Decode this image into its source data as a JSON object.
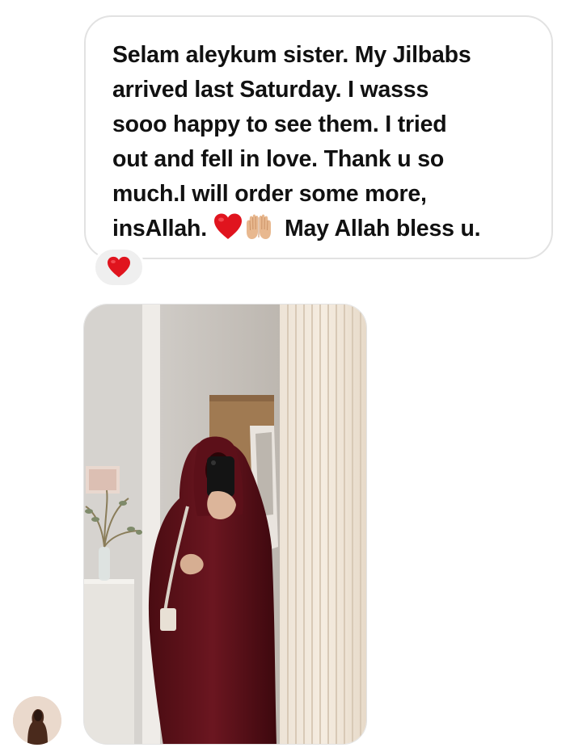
{
  "message": {
    "lines": [
      "Selam aleykum sister. My Jilbabs",
      "arrived last Saturday. I wasss",
      "sooo happy to see them. I tried",
      "out and fell in love. Thank u so",
      "much.I  will order some more,"
    ],
    "last_line_start": "insAllah.",
    "last_line_end": "May Allah bless u.",
    "inline_emojis": [
      "red-heart",
      "palms-up-together"
    ]
  },
  "reaction": {
    "emoji": "red-heart"
  },
  "photo": {
    "kind": "mirror-selfie"
  },
  "avatar": {
    "kind": "profile-photo"
  },
  "colors": {
    "bubble_border": "#e2e2e2",
    "text": "#111111",
    "reaction_bg": "#efefef",
    "heart": "#e0141e"
  }
}
